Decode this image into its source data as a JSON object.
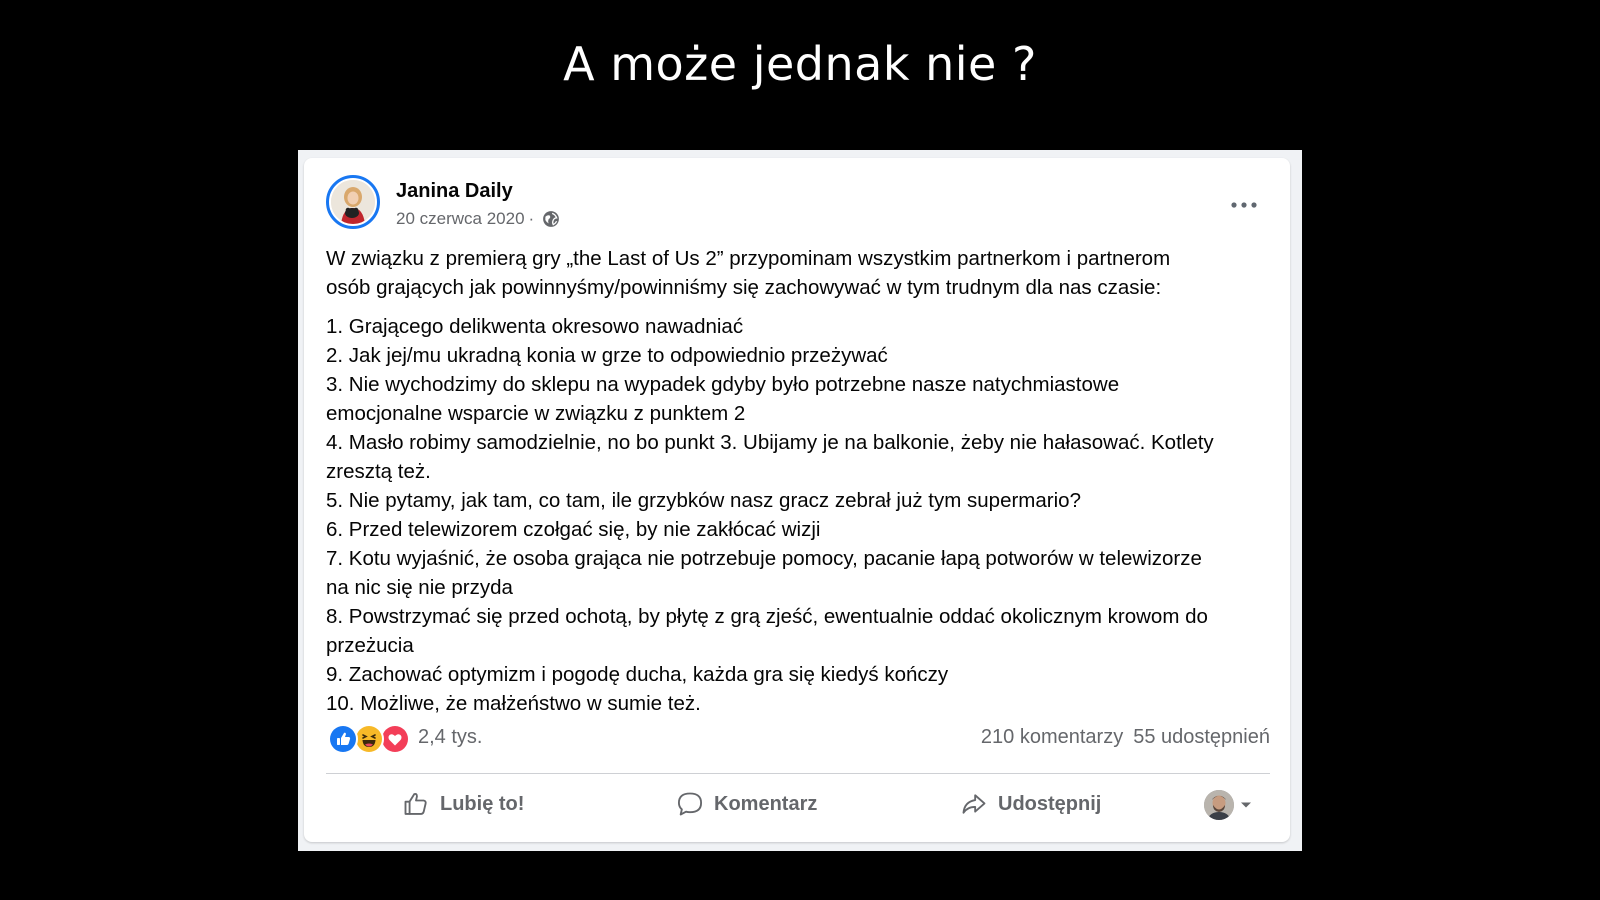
{
  "slide": {
    "title": "A może jednak nie ?"
  },
  "post": {
    "author": "Janina Daily",
    "date": "20 czerwca 2020",
    "separator": "·",
    "privacy_icon": "globe-icon",
    "more_icon": "more-horizontal-icon",
    "intro_lines": [
      "W związku z premierą gry „the Last of Us 2” przypominam wszystkim partnerkom i partnerom",
      "osób grających jak powinnyśmy/powinniśmy się zachowywać w tym trudnym dla nas czasie:"
    ],
    "list_lines": [
      "1. Grającego delikwenta okresowo nawadniać",
      "2. Jak jej/mu ukradną konia w grze to odpowiednio przeżywać",
      "3. Nie wychodzimy do sklepu na wypadek gdyby było potrzebne nasze natychmiastowe",
      "emocjonalne wsparcie w związku z punktem 2",
      "4. Masło robimy samodzielnie, no bo punkt 3. Ubijamy je na balkonie, żeby nie hałasować. Kotlety",
      "zresztą też.",
      "5. Nie pytamy, jak tam, co tam, ile grzybków nasz gracz zebrał już tym supermario?",
      "6. Przed telewizorem czołgać się, by nie zakłócać wizji",
      "7. Kotu wyjaśnić, że osoba grająca nie potrzebuje pomocy, pacanie łapą potworów w telewizorze",
      "na nic się nie przyda",
      "8. Powstrzymać się przed ochotą, by płytę z grą zjeść, ewentualnie oddać okolicznym krowom do",
      "przeżucia",
      "9. Zachować optymizm i pogodę ducha, każda gra się kiedyś kończy",
      "10. Możliwe, że małżeństwo w sumie też."
    ]
  },
  "stats": {
    "reaction_icons": [
      "like-reaction-icon",
      "haha-reaction-icon",
      "love-reaction-icon"
    ],
    "reactions_count": "2,4 tys.",
    "comments": "210 komentarzy",
    "shares": "55 udostępnień"
  },
  "actions": {
    "like_label": "Lubię to!",
    "comment_label": "Komentarz",
    "share_label": "Udostępnij"
  },
  "colors": {
    "background": "#000000",
    "card": "#ffffff",
    "frame": "#f0f2f5",
    "text": "#050505",
    "secondary_text": "#65676b",
    "accent": "#1877f2",
    "like_blue": "#1877f2",
    "haha_yellow": "#f7b928",
    "love_red": "#f33e58"
  }
}
